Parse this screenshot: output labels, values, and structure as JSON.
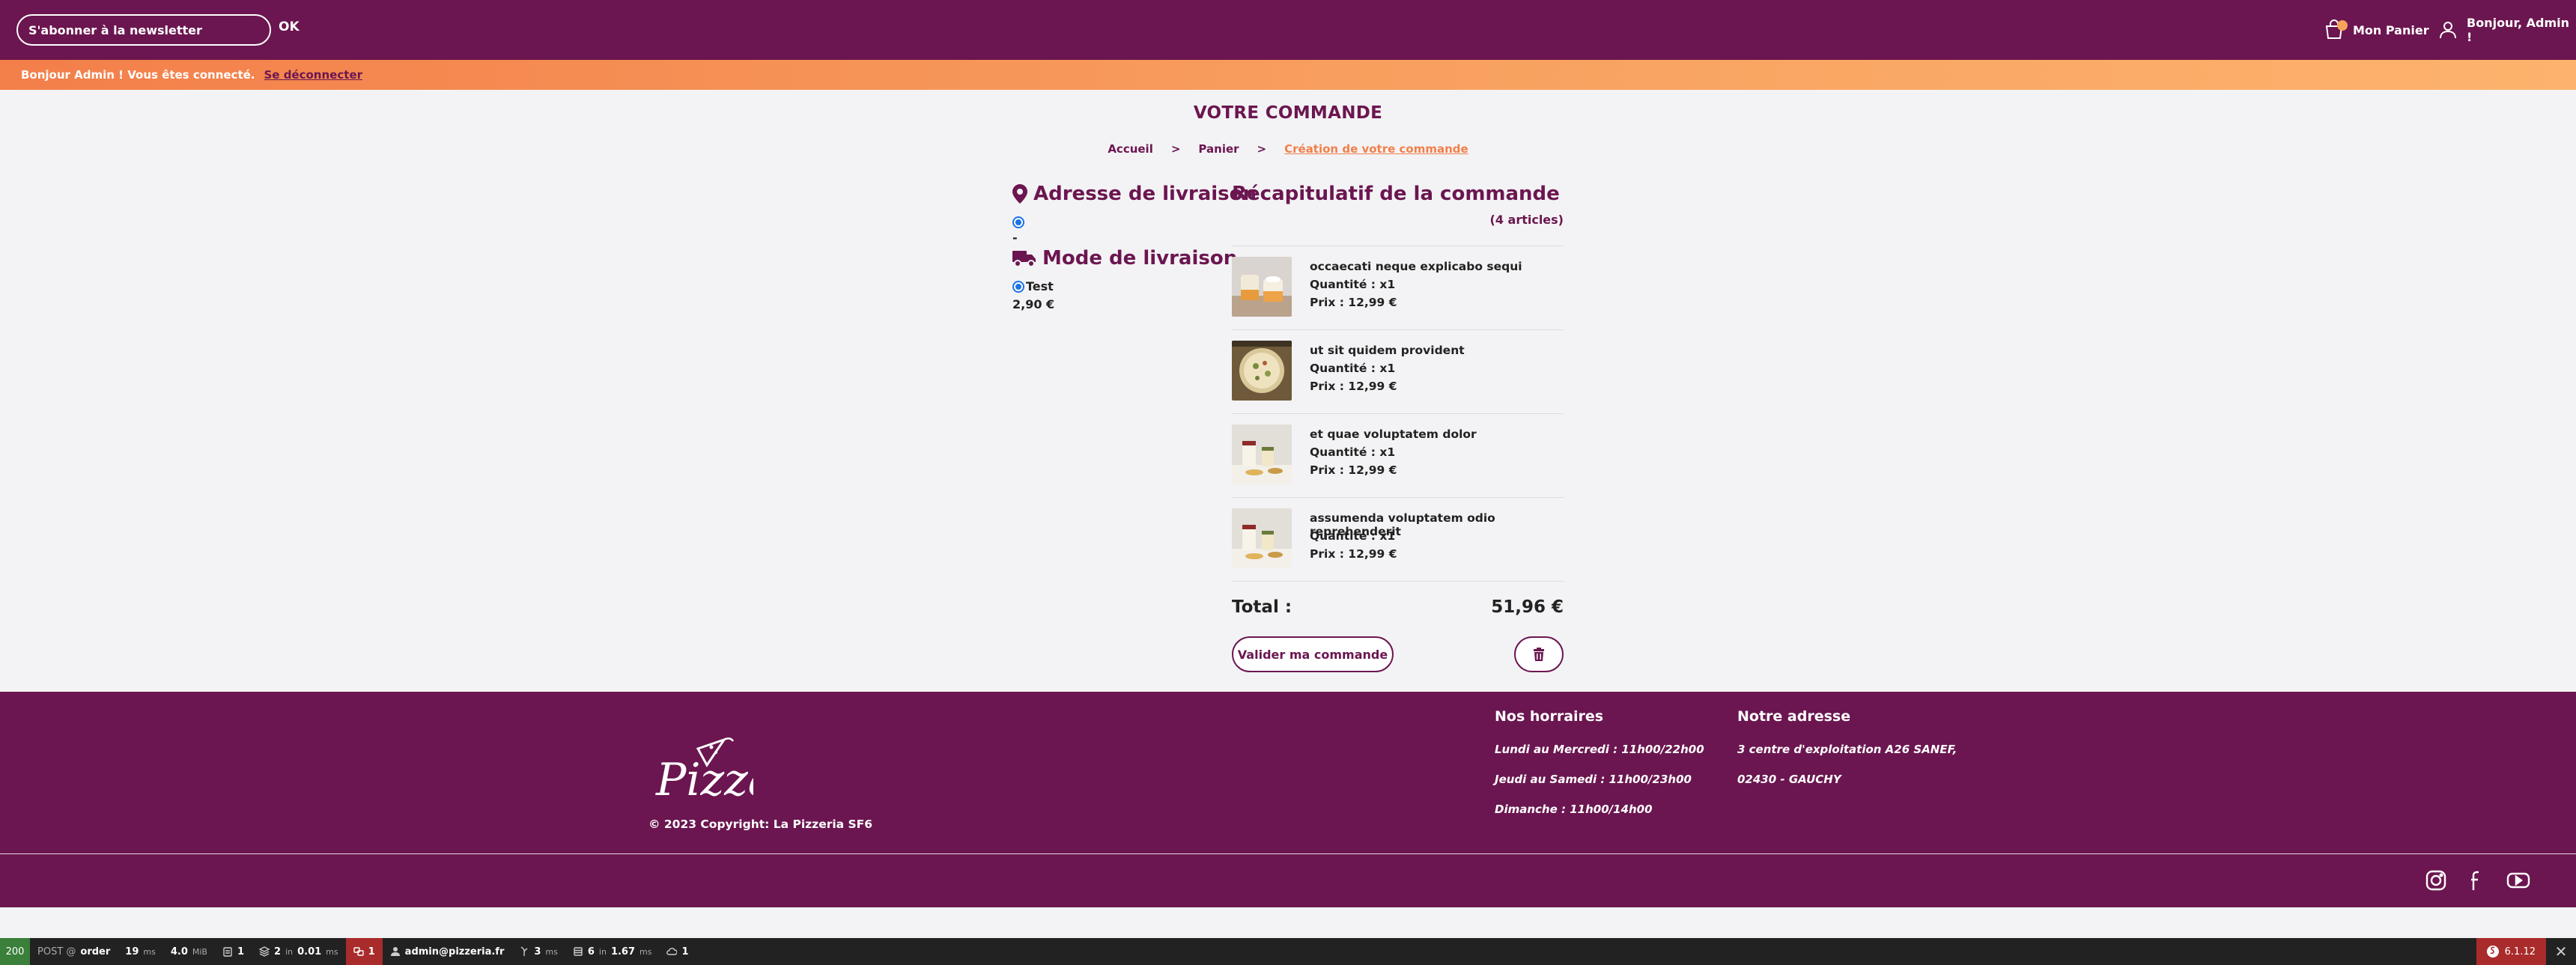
{
  "topbar": {
    "newsletter_placeholder": "S'abonner à la newsletter",
    "ok_label": "OK",
    "cart_label": "Mon Panier",
    "user_greeting": "Bonjour, Admin !"
  },
  "flash": {
    "message": "Bonjour Admin ! Vous êtes connecté.",
    "logout_label": "Se déconnecter"
  },
  "main": {
    "title": "VOTRE COMMANDE",
    "breadcrumb": [
      "Accueil",
      "Panier",
      "Création de votre commande"
    ],
    "breadcrumb_sep": ">",
    "address_title": "Adresse de livraison",
    "address_value": "-",
    "delivery_title": "Mode de livraison",
    "delivery_option": "Test",
    "delivery_price": "2,90 €",
    "recap_title": "Récapitulatif de la commande",
    "recap_count": "(4 articles)",
    "items": [
      {
        "name": "occaecati neque explicabo sequi",
        "qty": "Quantité : x1",
        "price": "Prix : 12,99 €",
        "image": "dessert-cups"
      },
      {
        "name": "ut sit quidem provident",
        "qty": "Quantité : x1",
        "price": "Prix : 12,99 €",
        "image": "pizza"
      },
      {
        "name": "et quae voluptatem dolor",
        "qty": "Quantité : x1",
        "price": "Prix : 12,99 €",
        "image": "drinks"
      },
      {
        "name": "assumenda voluptatem odio reprehenderit",
        "qty": "Quantité : x1",
        "price": "Prix : 12,99 €",
        "image": "drinks"
      }
    ],
    "total_label": "Total :",
    "total_value": "51,96 €",
    "validate_label": "Valider ma commande"
  },
  "footer": {
    "logo_text": "Pizza",
    "copyright": "© 2023 Copyright: La Pizzeria SF6",
    "hours_title": "Nos horraires",
    "hours": [
      "Lundi au Mercredi : 11h00/22h00",
      "Jeudi au Samedi : 11h00/23h00",
      "Dimanche : 11h00/14h00"
    ],
    "address_title": "Notre adresse",
    "address_lines": [
      "3 centre d'exploitation A26 SANEF,",
      "02430 - GAUCHY"
    ]
  },
  "devbar": {
    "status": "200",
    "method": "POST @",
    "route": "order",
    "time": "19",
    "time_unit": "ms",
    "memory": "4.0",
    "memory_unit": "MiB",
    "forms": "1",
    "cache": "2",
    "cache_in": "in",
    "cache_time": "0.01",
    "cache_unit": "ms",
    "translation": "1",
    "user": "admin@pizzeria.fr",
    "twig_time": "3",
    "twig_unit": "ms",
    "db_queries": "6",
    "db_in": "in",
    "db_time": "1.67",
    "db_unit": "ms",
    "mailer": "1",
    "version": "6.1.12"
  },
  "colors": {
    "brand": "#6b1650",
    "accent": "#f37f4a",
    "background": "#f3f3f5"
  }
}
